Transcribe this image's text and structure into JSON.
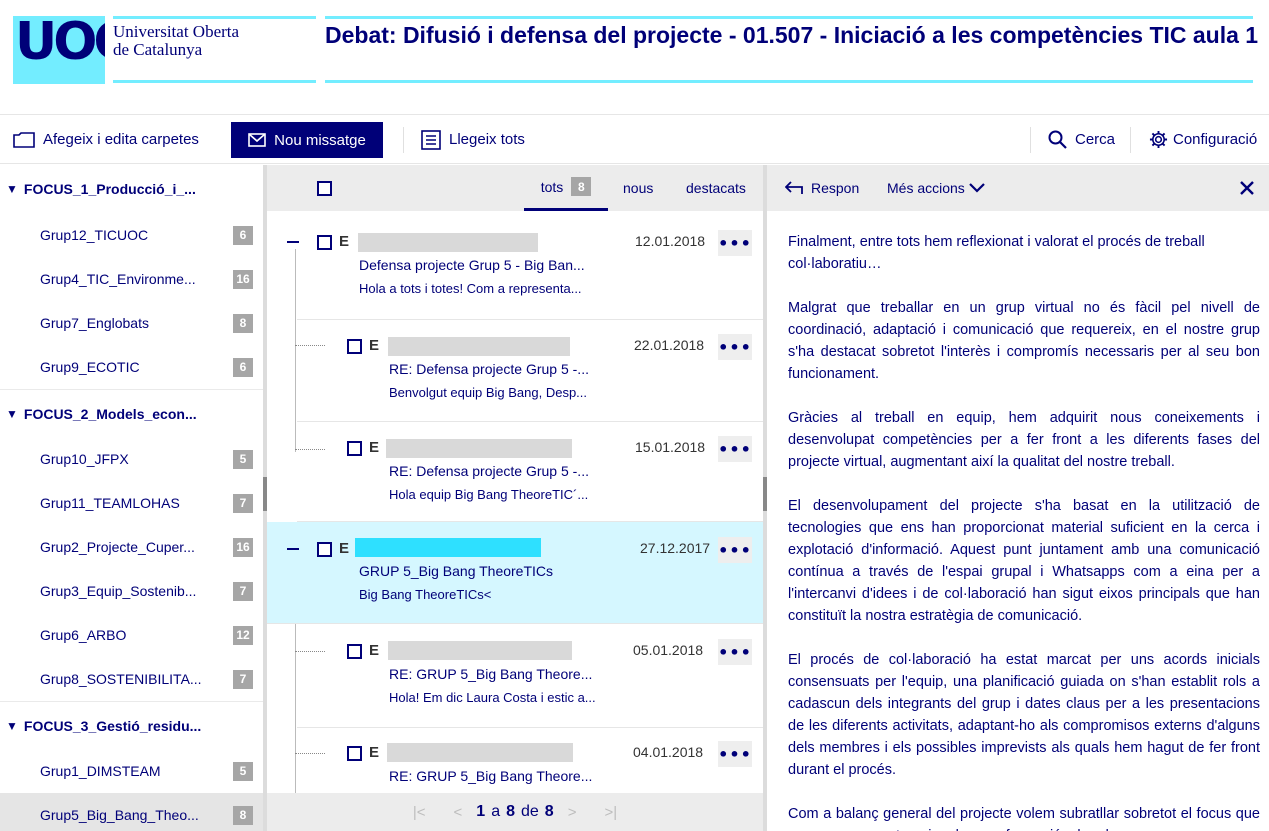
{
  "header": {
    "logo_letters": "UOC",
    "logo_line1": "Universitat Oberta",
    "logo_line2": "de Catalunya",
    "title": "Debat: Difusió i defensa del projecte - 01.507 - Iniciació a les competències TIC aula 1"
  },
  "toolbar": {
    "folders_label": "Afegeix i edita carpetes",
    "new_message_label": "Nou missatge",
    "read_all_label": "Llegeix tots",
    "search_label": "Cerca",
    "settings_label": "Configuració"
  },
  "sidebar": {
    "folders": [
      {
        "name": "FOCUS_1_Producció_i_...",
        "groups": [
          {
            "name": "Grup12_TICUOC",
            "count": "6"
          },
          {
            "name": "Grup4_TIC_Environme...",
            "count": "16"
          },
          {
            "name": "Grup7_Englobats",
            "count": "8"
          },
          {
            "name": "Grup9_ECOTIC",
            "count": "6"
          }
        ]
      },
      {
        "name": "FOCUS_2_Models_econ...",
        "groups": [
          {
            "name": "Grup10_JFPX",
            "count": "5"
          },
          {
            "name": "Grup11_TEAMLOHAS",
            "count": "7"
          },
          {
            "name": "Grup2_Projecte_Cuper...",
            "count": "16"
          },
          {
            "name": "Grup3_Equip_Sostenib...",
            "count": "7"
          },
          {
            "name": "Grup6_ARBO",
            "count": "12"
          },
          {
            "name": "Grup8_SOSTENIBILITA...",
            "count": "7"
          }
        ]
      },
      {
        "name": "FOCUS_3_Gestió_residu...",
        "groups": [
          {
            "name": "Grup1_DIMSTEAM",
            "count": "5"
          },
          {
            "name": "Grup5_Big_Bang_Theo...",
            "count": "8"
          }
        ]
      }
    ]
  },
  "list": {
    "tabs": {
      "all": "tots",
      "all_count": "8",
      "new": "nous",
      "starred": "destacats"
    },
    "messages": [
      {
        "initial": "E",
        "date": "12.01.2018",
        "subject": "Defensa projecte Grup 5 - Big Ban...",
        "preview": "Hola a tots i totes! Com a representa...",
        "more": "•••"
      },
      {
        "initial": "E",
        "date": "22.01.2018",
        "subject": "RE: Defensa projecte Grup 5 -...",
        "preview": "Benvolgut equip Big Bang, Desp...",
        "more": "•••"
      },
      {
        "initial": "E",
        "date": "15.01.2018",
        "subject": "RE: Defensa projecte Grup 5 -...",
        "preview": "Hola equip Big Bang TheoreTIC´...",
        "more": "•••"
      },
      {
        "initial": "E",
        "date": "27.12.2017",
        "subject": "GRUP 5_Big Bang TheoreTICs",
        "preview": "Big Bang TheoreTICs<",
        "more": "•••"
      },
      {
        "initial": "E",
        "date": "05.01.2018",
        "subject": "RE: GRUP 5_Big Bang Theore...",
        "preview": "Hola! Em dic Laura Costa i estic a...",
        "more": "•••"
      },
      {
        "initial": "E",
        "date": "04.01.2018",
        "subject": "RE: GRUP 5_Big Bang Theore...",
        "preview": "",
        "more": "•••"
      }
    ],
    "pager": {
      "current": "1",
      "a": "a",
      "page_end": "8",
      "de": "de",
      "total": "8"
    }
  },
  "reader": {
    "reply_label": "Respon",
    "more_actions_label": "Més accions",
    "paragraphs": [
      "Finalment, entre tots hem reflexionat i valorat el procés de treball col·laboratiu…",
      "Malgrat que treballar en un grup virtual no és fàcil pel nivell de coordinació, adaptació i comunicació que requereix, en el nostre grup s'ha destacat sobretot l'interès i compromís necessaris per al seu bon funcionament.",
      "Gràcies al treball en equip, hem adquirit nous coneixements i desenvolupat competències per a fer front a les diferents fases del projecte virtual, augmentant així la qualitat del nostre treball.",
      "El desenvolupament del projecte s'ha basat en la utilització de tecnologies que ens han proporcionat material suficient en la cerca i explotació d'informació. Aquest punt juntament amb una comunicació contínua a través de l'espai grupal i Whatsapps com a eina per a l'intercanvi d'idees i de col·laboració han sigut eixos principals que han constituït la nostra estratègia de comunicació.",
      "El procés de col·laboració ha estat marcat per uns acords inicials consensuats per l'equip, una planificació guiada on s'han establit rols a cadascun dels integrants del grup i dates claus per a les presentacions de les diferents activitats, adaptant-ho als compromisos externs d'alguns dels membres i els possibles imprevists als quals hem hagut de fer front durant el procés.",
      "Com a balanç general del projecte volem subratllar sobretot el focus que va crear o aquest equip a la seva formació, el poder"
    ]
  },
  "colors": {
    "brand": "#000078",
    "accent": "#73edff",
    "selected_row": "#d5f7ff"
  }
}
